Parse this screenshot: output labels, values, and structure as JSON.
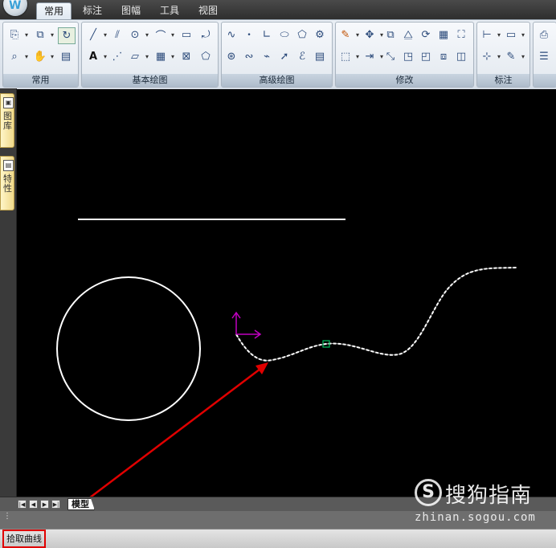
{
  "menu": {
    "logo_glyph": "W",
    "tabs": [
      "常用",
      "标注",
      "图幅",
      "工具",
      "视图"
    ],
    "active_tab": "常用"
  },
  "ribbon": {
    "panels": [
      "常用",
      "基本绘图",
      "高级绘图",
      "修改",
      "标注"
    ]
  },
  "side_tabs": [
    "图库",
    "特性"
  ],
  "layout_tabs": {
    "nav_glyphs": [
      "|◀",
      "◀",
      "▶",
      "▶|"
    ],
    "model_tab": "模型"
  },
  "status": {
    "prompt": "拾取曲线"
  },
  "watermark": {
    "logo": "S",
    "text": "搜狗指南",
    "url": "zhinan.sogou.com"
  },
  "colors": {
    "canvas": "#000000",
    "entity": "#ffffff",
    "ucs_axis": "#c000c0",
    "grip": "#00c060",
    "annotation_arrow": "#e00000"
  }
}
